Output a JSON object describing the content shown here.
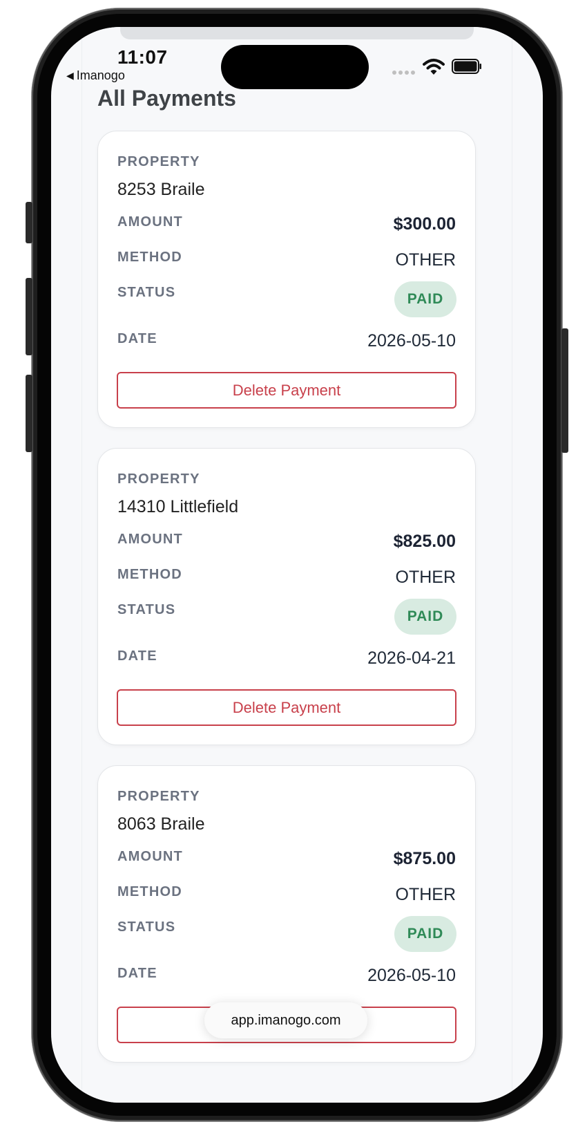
{
  "status_bar": {
    "time": "11:07",
    "back_app": "Imanogo"
  },
  "page": {
    "title": "All Payments"
  },
  "labels": {
    "property": "PROPERTY",
    "amount": "AMOUNT",
    "method": "METHOD",
    "status": "STATUS",
    "date": "DATE",
    "delete": "Delete Payment"
  },
  "payments": [
    {
      "property": "8253 Braile",
      "amount": "$300.00",
      "method": "OTHER",
      "status": "PAID",
      "date": "2026-05-10"
    },
    {
      "property": "14310 Littlefield",
      "amount": "$825.00",
      "method": "OTHER",
      "status": "PAID",
      "date": "2026-04-21"
    },
    {
      "property": "8063 Braile",
      "amount": "$875.00",
      "method": "OTHER",
      "status": "PAID",
      "date": "2026-05-10"
    }
  ],
  "browser": {
    "url": "app.imanogo.com"
  },
  "colors": {
    "accent_red": "#c8404b",
    "paid_bg": "#d8ebe1",
    "paid_text": "#2f8a57"
  }
}
